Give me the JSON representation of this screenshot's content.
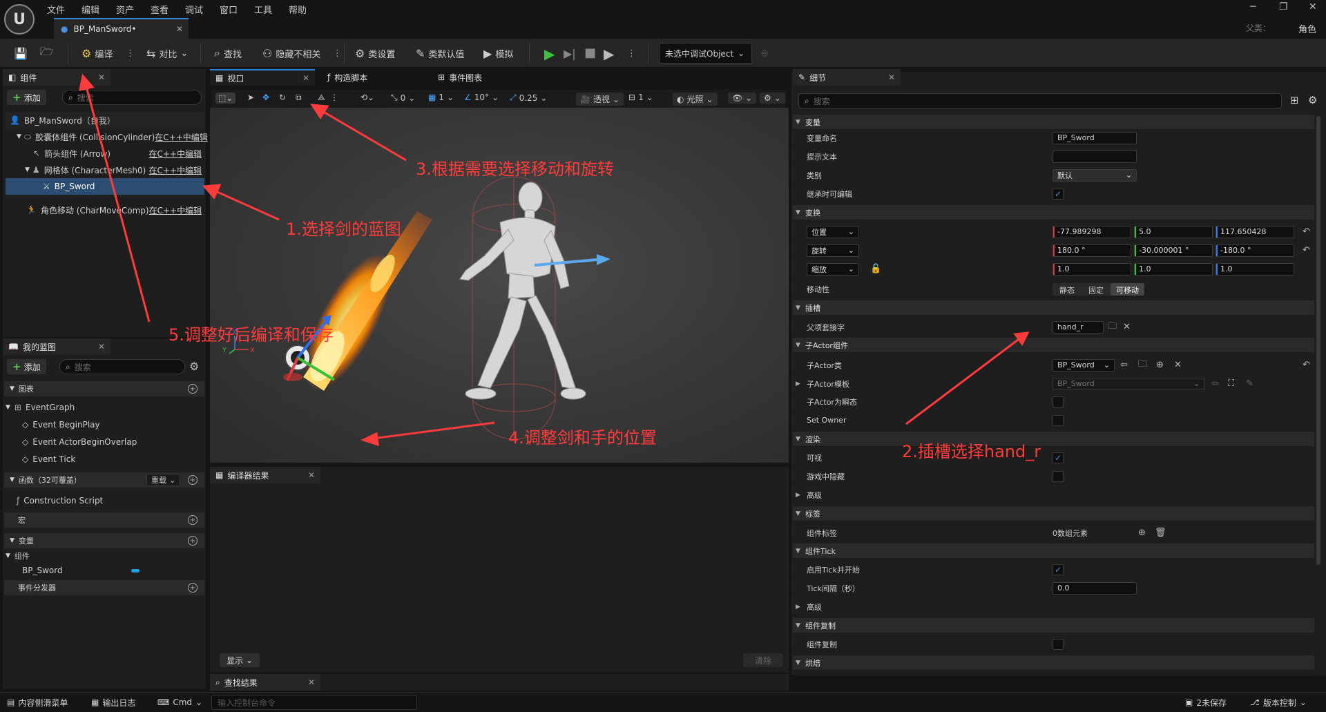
{
  "menu": [
    "文件",
    "编辑",
    "资产",
    "查看",
    "调试",
    "窗口",
    "工具",
    "帮助"
  ],
  "doc_tab": {
    "title": "BP_ManSword•"
  },
  "parent": {
    "label": "父类：",
    "value": "角色"
  },
  "toolbar": {
    "compile": "编译",
    "diff": "对比",
    "find": "查找",
    "hide_unrelated": "隐藏不相关",
    "class_settings": "类设置",
    "class_defaults": "类默认值",
    "simulate": "模拟",
    "debug_object": "未选中调试Object"
  },
  "components_panel": {
    "tab": "组件",
    "add": "添加",
    "search_placeholder": "搜索",
    "items": [
      {
        "name": "BP_ManSword（自我）",
        "link": ""
      },
      {
        "name": "胶囊体组件 (CollisionCylinder)",
        "link": "在C++中编辑"
      },
      {
        "name": "箭头组件 (Arrow)",
        "link": "在C++中编辑"
      },
      {
        "name": "网格体 (CharacterMesh0)",
        "link": "在C++中编辑"
      },
      {
        "name": "BP_Sword",
        "link": ""
      },
      {
        "name": "角色移动 (CharMoveComp)",
        "link": "在C++中编辑"
      }
    ]
  },
  "my_blueprint": {
    "tab": "我的蓝图",
    "add": "添加",
    "search_placeholder": "搜索",
    "graphs_header": "图表",
    "event_graph": "EventGraph",
    "events": [
      "Event BeginPlay",
      "Event ActorBeginOverlap",
      "Event Tick"
    ],
    "functions_header": "函数（32可覆盖）",
    "override": "重载",
    "construction_script": "Construction Script",
    "macros_header": "宏",
    "variables_header": "变量",
    "components_header": "组件",
    "component_var": "BP_Sword",
    "dispatchers_header": "事件分发器"
  },
  "center_tabs": {
    "viewport": "视口",
    "construction": "构造脚本",
    "event_graph": "事件图表"
  },
  "viewport_toolbar": {
    "rot_snap": "0",
    "grid_snap": "1",
    "angle_snap": "10°",
    "scale_snap": "0.25",
    "perspective": "透视",
    "lighting": "光照",
    "speed": "1"
  },
  "compiler": {
    "tab": "编译器结果",
    "show": "显示",
    "clear": "清除"
  },
  "find_results": {
    "tab": "查找结果"
  },
  "details": {
    "tab": "细节",
    "search_placeholder": "搜索",
    "sections": {
      "variable": "变量",
      "transform": "变换",
      "sockets": "插槽",
      "child_actor": "子Actor组件",
      "rendering": "渲染",
      "advanced": "高级",
      "tags": "标签",
      "component_tick": "组件Tick",
      "advanced2": "高级",
      "replication": "组件复制",
      "cooking": "烘焙"
    },
    "rows": {
      "var_name_label": "变量命名",
      "var_name": "BP_Sword",
      "tooltip_label": "提示文本",
      "category_label": "类别",
      "category": "默认",
      "editable_label": "继承时可编辑",
      "location_label": "位置",
      "location": [
        "-77.989298",
        "5.0",
        "117.650428"
      ],
      "rotation_label": "旋转",
      "rotation": [
        "180.0 °",
        "-30.000001 °",
        "-180.0 °"
      ],
      "scale_label": "缩放",
      "scale": [
        "1.0",
        "1.0",
        "1.0"
      ],
      "mobility_label": "移动性",
      "mobility": [
        "静态",
        "固定",
        "可移动"
      ],
      "parent_socket_label": "父项套接字",
      "parent_socket": "hand_r",
      "child_class_label": "子Actor类",
      "child_class": "BP_Sword",
      "child_template_label": "子Actor模板",
      "child_template": "BP_Sword",
      "child_transient_label": "子Actor为瞬态",
      "set_owner_label": "Set Owner",
      "visible_label": "可视",
      "hidden_in_game_label": "游戏中隐藏",
      "component_tags_label": "组件标签",
      "component_tags": "0数组元素",
      "start_tick_label": "启用Tick并开始",
      "tick_interval_label": "Tick间隔（秒）",
      "tick_interval": "0.0",
      "replicates_label": "组件复制"
    }
  },
  "annotations": {
    "a1": "1.选择剑的蓝图",
    "a2": "2.插槽选择hand_r",
    "a3": "3.根据需要选择移动和旋转",
    "a4": "4.调整剑和手的位置",
    "a5": "5.调整好后编译和保存"
  },
  "statusbar": {
    "content_drawer": "内容侧滑菜单",
    "output_log": "输出日志",
    "cmd": "Cmd",
    "console_placeholder": "输入控制台命令",
    "unsaved": "2未保存",
    "source_control": "版本控制"
  },
  "colors": {
    "accent": "#2d86d6",
    "annotation": "#ff3b3b",
    "play": "#3fbf3f"
  }
}
